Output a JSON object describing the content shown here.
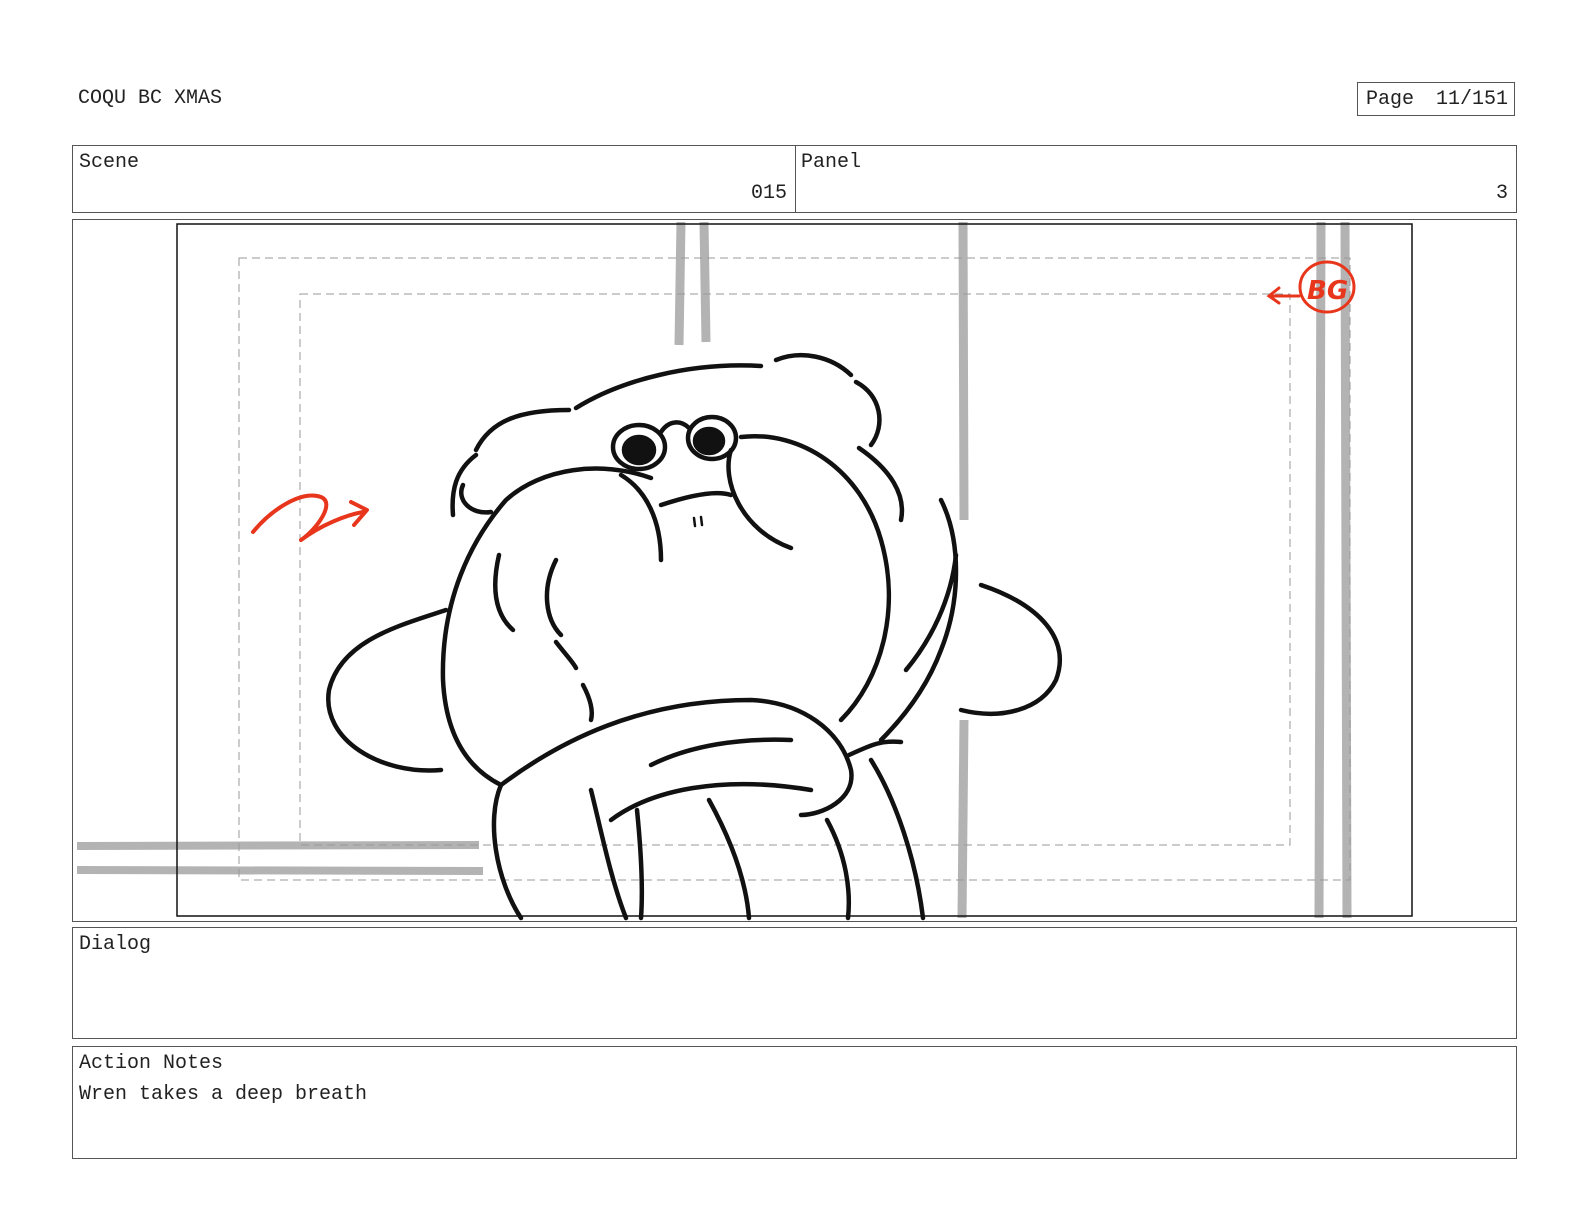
{
  "header": {
    "project_title": "COQU BC XMAS",
    "page_label": "Page",
    "page_value": "11/151"
  },
  "scene": {
    "label": "Scene",
    "value": "015"
  },
  "panel": {
    "label": "Panel",
    "value": "3"
  },
  "drawing": {
    "description_icons": [
      "character-sketch",
      "camera-move-arrow",
      "bg-note"
    ],
    "annotation_color": "#e8361c",
    "annotation_text": "BG"
  },
  "dialog": {
    "label": "Dialog",
    "text": ""
  },
  "action_notes": {
    "label": "Action Notes",
    "text": "Wren takes a deep breath"
  }
}
